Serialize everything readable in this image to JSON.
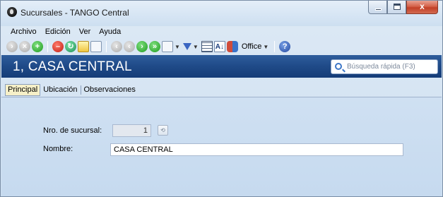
{
  "window": {
    "title": "Sucursales - TANGO Central",
    "controls": {
      "minimize": "–",
      "maximize": "□",
      "close": "x"
    }
  },
  "menu": [
    {
      "label": "Archivo"
    },
    {
      "label": "Edición"
    },
    {
      "label": "Ver"
    },
    {
      "label": "Ayuda"
    }
  ],
  "toolbar": {
    "office_label": "Office",
    "icons": [
      "first-icon",
      "prev-icon",
      "add-icon",
      "delete-icon",
      "refresh-icon",
      "note-icon",
      "document-icon",
      "nav-first-icon",
      "nav-prev-icon",
      "nav-next-icon",
      "nav-last-icon",
      "binoculars-icon",
      "filter-icon",
      "grid-icon",
      "sort-icon",
      "people-icon",
      "help-icon"
    ]
  },
  "header": {
    "title": "1, CASA CENTRAL",
    "search_placeholder": "Búsqueda rápida (F3)"
  },
  "tabs": [
    {
      "label": "Principal",
      "active": true
    },
    {
      "label": "Ubicación",
      "active": false
    },
    {
      "label": "Observaciones",
      "active": false
    }
  ],
  "form": {
    "sucursal_label": "Nro. de sucursal:",
    "sucursal_value": "1",
    "nombre_label": "Nombre:",
    "nombre_value": "CASA CENTRAL"
  },
  "colors": {
    "header_bg": "#1f4a88",
    "window_bg": "#cfe0f2",
    "active_tab_bg": "#f6f0c8",
    "close_button": "#c23f27"
  }
}
